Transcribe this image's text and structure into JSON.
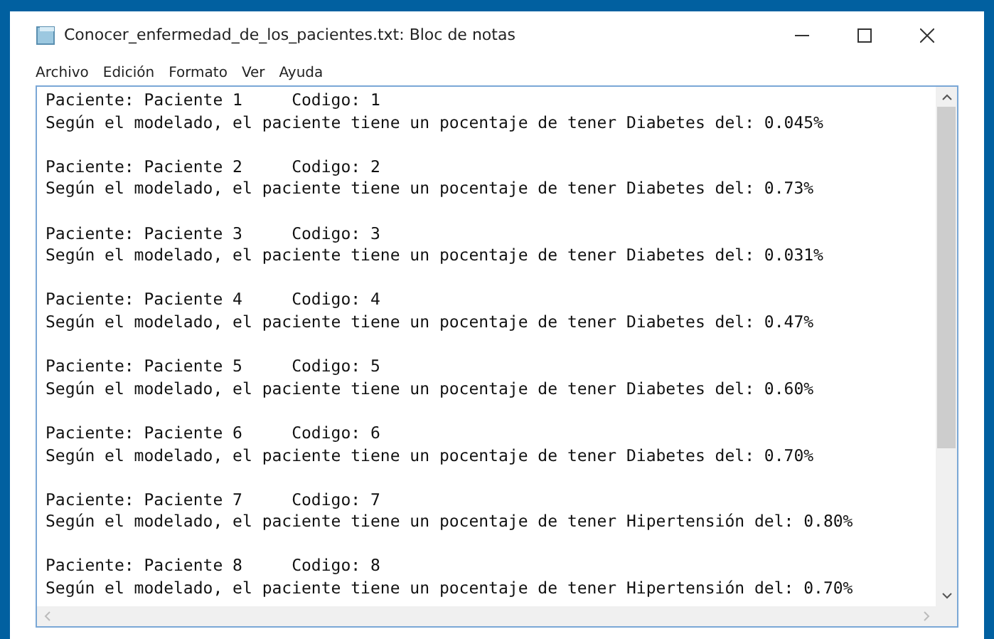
{
  "window": {
    "title": "Conocer_enfermedad_de_los_pacientes.txt: Bloc de notas"
  },
  "menu": [
    "Archivo",
    "Edición",
    "Formato",
    "Ver",
    "Ayuda"
  ],
  "document": {
    "entries": [
      {
        "header": "Paciente: Paciente 1     Codigo: 1",
        "result": "Según el modelado, el paciente tiene un pocentaje de tener Diabetes del: 0.045%"
      },
      {
        "header": "Paciente: Paciente 2     Codigo: 2",
        "result": "Según el modelado, el paciente tiene un pocentaje de tener Diabetes del: 0.73%"
      },
      {
        "header": "Paciente: Paciente 3     Codigo: 3",
        "result": "Según el modelado, el paciente tiene un pocentaje de tener Diabetes del: 0.031%"
      },
      {
        "header": "Paciente: Paciente 4     Codigo: 4",
        "result": "Según el modelado, el paciente tiene un pocentaje de tener Diabetes del: 0.47%"
      },
      {
        "header": "Paciente: Paciente 5     Codigo: 5",
        "result": "Según el modelado, el paciente tiene un pocentaje de tener Diabetes del: 0.60%"
      },
      {
        "header": "Paciente: Paciente 6     Codigo: 6",
        "result": "Según el modelado, el paciente tiene un pocentaje de tener Diabetes del: 0.70%"
      },
      {
        "header": "Paciente: Paciente 7     Codigo: 7",
        "result": "Según el modelado, el paciente tiene un pocentaje de tener Hipertensión del: 0.80%"
      },
      {
        "header": "Paciente: Paciente 8     Codigo: 8",
        "result": "Según el modelado, el paciente tiene un pocentaje de tener Hipertensión del: 0.70%"
      }
    ]
  }
}
